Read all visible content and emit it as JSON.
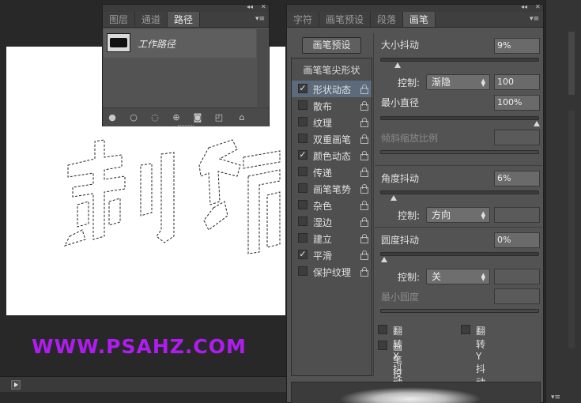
{
  "watermark": "WWW.PSAHZ.COM",
  "paths_panel": {
    "tabs": [
      {
        "label": "图层",
        "active": false
      },
      {
        "label": "通道",
        "active": false
      },
      {
        "label": "路径",
        "active": true
      }
    ],
    "path_name": "工作路径",
    "footer_icons": [
      "fill-path-icon",
      "stroke-path-icon",
      "load-selection-icon",
      "make-work-path-icon",
      "add-mask-icon",
      "new-path-icon",
      "delete-path-icon"
    ]
  },
  "brush_panel": {
    "tabs": [
      {
        "label": "字符",
        "active": false
      },
      {
        "label": "画笔预设",
        "active": false
      },
      {
        "label": "段落",
        "active": false
      },
      {
        "label": "画笔",
        "active": true
      }
    ],
    "preset_button": "画笔预设",
    "tip_shape_header": "画笔笔尖形状",
    "categories": [
      {
        "label": "形状动态",
        "checked": true,
        "selected": true
      },
      {
        "label": "散布",
        "checked": false,
        "selected": false
      },
      {
        "label": "纹理",
        "checked": false,
        "selected": false
      },
      {
        "label": "双重画笔",
        "checked": false,
        "selected": false
      },
      {
        "label": "颜色动态",
        "checked": true,
        "selected": false
      },
      {
        "label": "传递",
        "checked": false,
        "selected": false
      },
      {
        "label": "画笔笔势",
        "checked": false,
        "selected": false
      },
      {
        "label": "杂色",
        "checked": false,
        "selected": false
      },
      {
        "label": "湿边",
        "checked": false,
        "selected": false
      },
      {
        "label": "建立",
        "checked": false,
        "selected": false
      },
      {
        "label": "平滑",
        "checked": true,
        "selected": false
      },
      {
        "label": "保护纹理",
        "checked": false,
        "selected": false
      }
    ],
    "size_jitter": {
      "label": "大小抖动",
      "value": "9%",
      "level": 0.09
    },
    "size_control": {
      "label": "控制:",
      "option": "渐隐",
      "value": "100"
    },
    "min_diameter": {
      "label": "最小直径",
      "value": "100%",
      "level": 1.0
    },
    "tilt_scale": {
      "label": "倾斜缩放比例"
    },
    "angle_jitter": {
      "label": "角度抖动",
      "value": "6%",
      "level": 0.06
    },
    "angle_control": {
      "label": "控制:",
      "option": "方向"
    },
    "roundness_jitter": {
      "label": "圆度抖动",
      "value": "0%",
      "level": 0.0
    },
    "roundness_control": {
      "label": "控制:",
      "option": "关"
    },
    "min_roundness": {
      "label": "最小圆度"
    },
    "flip_x": {
      "label": "翻转 X 抖动",
      "checked": false
    },
    "flip_y": {
      "label": "翻转 Y 抖动",
      "checked": false
    },
    "brush_projection": {
      "label": "画笔投影",
      "checked": false
    }
  },
  "colors": {
    "watermark": "#b01cf0",
    "selected_item": "#5b6b7c",
    "panel_bg": "#535353"
  }
}
